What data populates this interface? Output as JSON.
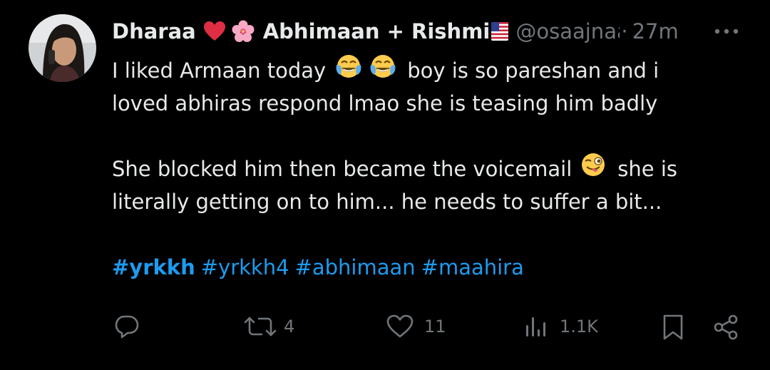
{
  "tweet": {
    "author": {
      "name_part1": "Dharaa",
      "name_part2": "Abhimaan + Rishmi",
      "handle": "@osaajnaa",
      "heart_icon": "red-heart-icon",
      "flower_icon": "cherry-blossom-icon",
      "flag_icon": "us-flag-icon"
    },
    "dot": "·",
    "time": "27m",
    "text": {
      "line1_a": "I liked Armaan today",
      "line1_b": "boy is so pareshan and i",
      "line2": "loved abhiras respond lmao she is teasing him badly",
      "line3_a": "She blocked him then became the voicemail",
      "line3_b": "she is",
      "line4": "literally getting on to him... he needs to suffer a bit..."
    },
    "hashtags": [
      "#yrkkh",
      "#yrkkh4",
      "#abhimaan",
      "#maahira"
    ],
    "actions": {
      "replies": "",
      "retweets": "4",
      "likes": "11",
      "views": "1.1K"
    },
    "colors": {
      "background": "#000000",
      "text": "#e7e9ea",
      "muted": "#71767b",
      "accent": "#1d9bf0"
    }
  }
}
